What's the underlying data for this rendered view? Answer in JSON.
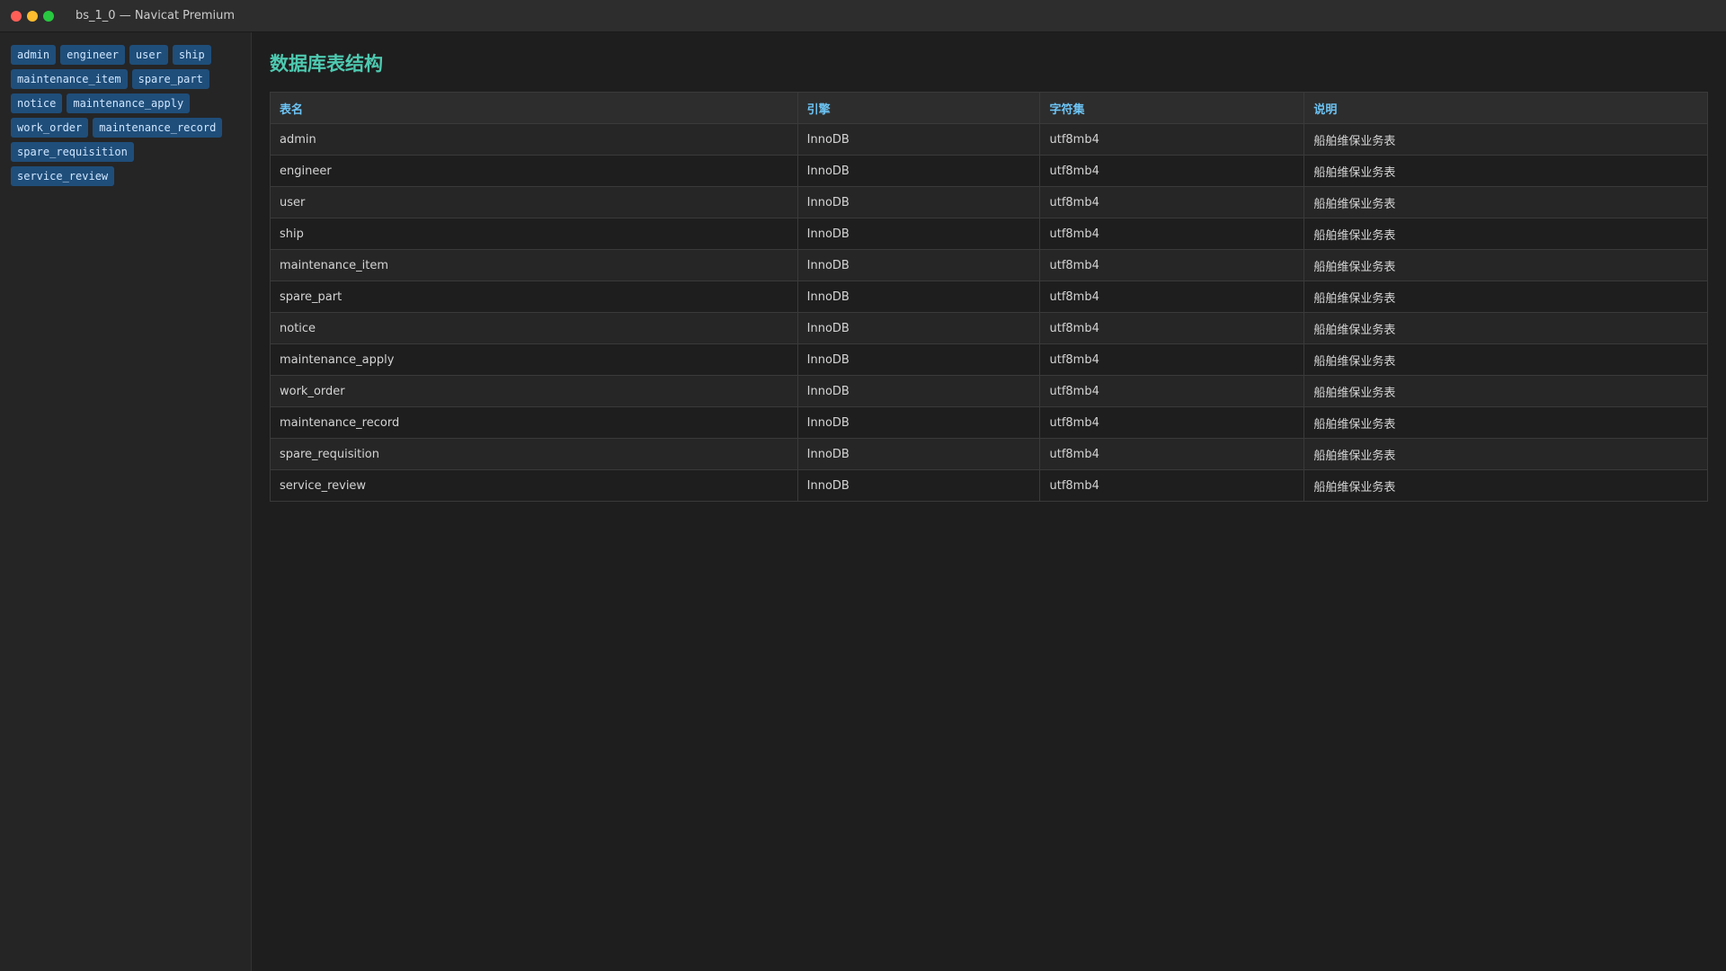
{
  "window": {
    "title": "bs_1_0 — Navicat Premium"
  },
  "sidebar": {
    "tags": [
      "admin",
      "engineer",
      "user",
      "ship",
      "maintenance_item",
      "spare_part",
      "notice",
      "maintenance_apply",
      "work_order",
      "maintenance_record",
      "spare_requisition",
      "service_review"
    ]
  },
  "main": {
    "title": "数据库表结构",
    "columns": [
      "表名",
      "引擎",
      "字符集",
      "说明"
    ],
    "rows": [
      [
        "admin",
        "InnoDB",
        "utf8mb4",
        "船舶维保业务表"
      ],
      [
        "engineer",
        "InnoDB",
        "utf8mb4",
        "船舶维保业务表"
      ],
      [
        "user",
        "InnoDB",
        "utf8mb4",
        "船舶维保业务表"
      ],
      [
        "ship",
        "InnoDB",
        "utf8mb4",
        "船舶维保业务表"
      ],
      [
        "maintenance_item",
        "InnoDB",
        "utf8mb4",
        "船舶维保业务表"
      ],
      [
        "spare_part",
        "InnoDB",
        "utf8mb4",
        "船舶维保业务表"
      ],
      [
        "notice",
        "InnoDB",
        "utf8mb4",
        "船舶维保业务表"
      ],
      [
        "maintenance_apply",
        "InnoDB",
        "utf8mb4",
        "船舶维保业务表"
      ],
      [
        "work_order",
        "InnoDB",
        "utf8mb4",
        "船舶维保业务表"
      ],
      [
        "maintenance_record",
        "InnoDB",
        "utf8mb4",
        "船舶维保业务表"
      ],
      [
        "spare_requisition",
        "InnoDB",
        "utf8mb4",
        "船舶维保业务表"
      ],
      [
        "service_review",
        "InnoDB",
        "utf8mb4",
        "船舶维保业务表"
      ]
    ]
  },
  "colors": {
    "accent_title": "#4ec9b0",
    "header_text": "#6cc4f5",
    "tag_bg": "#1f4e7a",
    "window_close": "#ff5f57",
    "window_minimize": "#febc2e",
    "window_zoom": "#28c840"
  }
}
